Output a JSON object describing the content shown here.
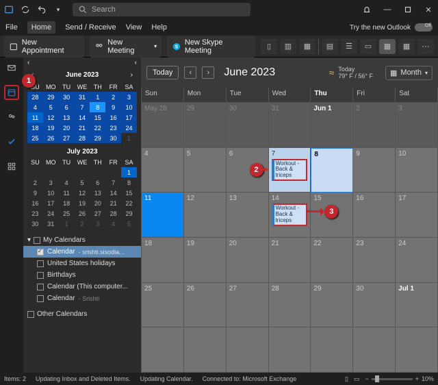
{
  "titlebar": {
    "search_placeholder": "Search"
  },
  "menubar": {
    "file": "File",
    "home": "Home",
    "sendreceive": "Send / Receive",
    "view": "View",
    "help": "Help",
    "try_text": "Try the new Outlook"
  },
  "ribbon": {
    "new_appt": "New Appointment",
    "new_meeting": "New Meeting",
    "new_skype": "New Skype Meeting"
  },
  "datepicker": {
    "month1_title": "June 2023",
    "month2_title": "July 2023",
    "dow": [
      "SU",
      "MO",
      "TU",
      "WE",
      "TH",
      "FR",
      "SA"
    ]
  },
  "calendars": {
    "group1": "My Calendars",
    "items": [
      {
        "label": "Calendar",
        "sub": " - srishti.sisodia..."
      },
      {
        "label": "United States holidays",
        "sub": ""
      },
      {
        "label": "Birthdays",
        "sub": ""
      },
      {
        "label": "Calendar (This computer...",
        "sub": ""
      },
      {
        "label": "Calendar",
        "sub": " - Srishti"
      }
    ],
    "group2": "Other Calendars"
  },
  "main": {
    "today_btn": "Today",
    "title": "June 2023",
    "weather_day": "Today",
    "weather_temp": "79° F / 56° F",
    "view_label": "Month",
    "dow": [
      "Sun",
      "Mon",
      "Tue",
      "Wed",
      "Thu",
      "Fri",
      "Sat"
    ],
    "events": {
      "e1": "Workout - Back & triceps",
      "e2": "Workout - Back & triceps"
    },
    "cells": {
      "r1": [
        "May 28",
        "29",
        "30",
        "31",
        "Jun 1",
        "2",
        "3"
      ],
      "r2": [
        "4",
        "5",
        "6",
        "7",
        "8",
        "9",
        "10"
      ],
      "r3": [
        "11",
        "12",
        "13",
        "14",
        "15",
        "16",
        "17"
      ],
      "r4": [
        "18",
        "19",
        "20",
        "21",
        "22",
        "23",
        "24"
      ],
      "r5": [
        "25",
        "26",
        "27",
        "28",
        "29",
        "30",
        "Jul 1"
      ]
    }
  },
  "status": {
    "items_label": "Items: 2",
    "msg1": "Updating Inbox and Deleted Items.",
    "msg2": "Updating Calendar.",
    "conn": "Connected to: Microsoft Exchange",
    "zoom": "10%"
  },
  "markers": {
    "m1": "1",
    "m2": "2",
    "m3": "3"
  }
}
